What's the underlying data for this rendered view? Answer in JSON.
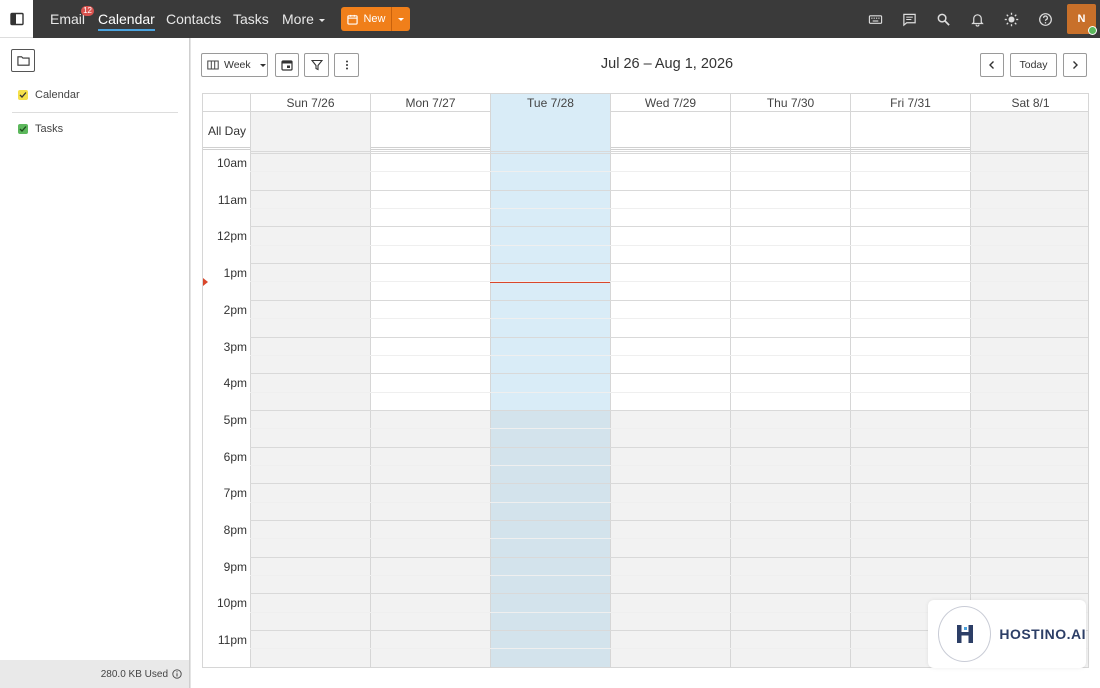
{
  "topbar": {
    "nav": [
      {
        "label": "Email",
        "badge": "12"
      },
      {
        "label": "Calendar"
      },
      {
        "label": "Contacts"
      },
      {
        "label": "Tasks"
      },
      {
        "label": "More"
      }
    ],
    "new_label": "New",
    "avatar_initial": "N",
    "icons": [
      "keyboard-icon",
      "chat-icon",
      "search-icon",
      "bell-icon",
      "brightness-icon",
      "help-icon"
    ]
  },
  "sidebar": {
    "calendars": [
      {
        "label": "Calendar",
        "color": "#f5e04a"
      },
      {
        "label": "Tasks",
        "color": "#5cb85c"
      }
    ],
    "storage": "280.0 KB Used"
  },
  "toolbar": {
    "view_label": "Week",
    "date_range": "Jul 26 – Aug 1, 2026",
    "today_label": "Today"
  },
  "calendar": {
    "days": [
      "Sun 7/26",
      "Mon 7/27",
      "Tue 7/28",
      "Wed 7/29",
      "Thu 7/30",
      "Fri 7/31",
      "Sat 8/1"
    ],
    "today_index": 2,
    "all_day_label": "All Day",
    "hours": [
      "10am",
      "11am",
      "12pm",
      "1pm",
      "2pm",
      "3pm",
      "4pm",
      "5pm",
      "6pm",
      "7pm",
      "8pm",
      "9pm",
      "10pm",
      "11pm"
    ],
    "work_end_hour_label": "5pm",
    "colors": {
      "today": "#d9ecf7",
      "today_offhours": "#d3e3ec",
      "offhours": "#f2f2f2",
      "now": "#d9472b"
    }
  },
  "watermark": {
    "text": "HOSTINO.AI",
    "letter": "H"
  }
}
